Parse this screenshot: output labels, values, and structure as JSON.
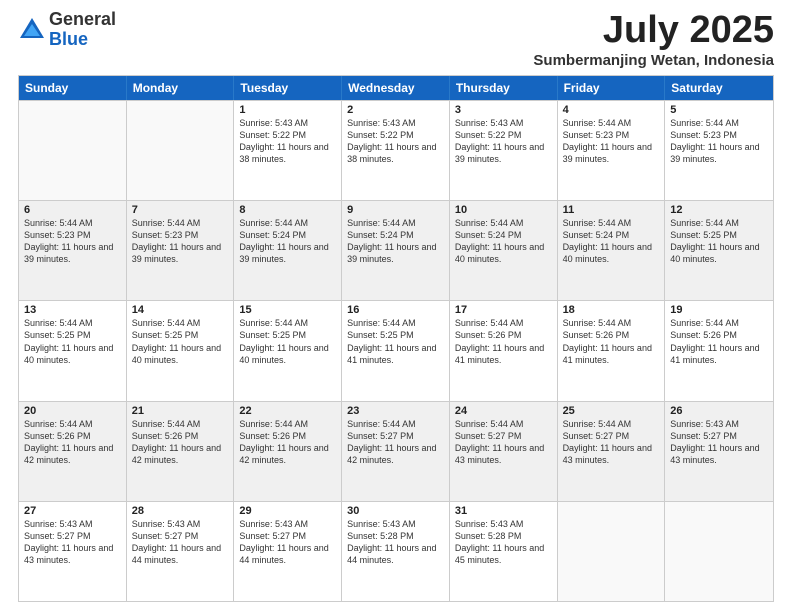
{
  "logo": {
    "general": "General",
    "blue": "Blue"
  },
  "title": "July 2025",
  "location": "Sumbermanjing Wetan, Indonesia",
  "header_days": [
    "Sunday",
    "Monday",
    "Tuesday",
    "Wednesday",
    "Thursday",
    "Friday",
    "Saturday"
  ],
  "weeks": [
    [
      {
        "day": "",
        "info": ""
      },
      {
        "day": "",
        "info": ""
      },
      {
        "day": "1",
        "info": "Sunrise: 5:43 AM\nSunset: 5:22 PM\nDaylight: 11 hours and 38 minutes."
      },
      {
        "day": "2",
        "info": "Sunrise: 5:43 AM\nSunset: 5:22 PM\nDaylight: 11 hours and 38 minutes."
      },
      {
        "day": "3",
        "info": "Sunrise: 5:43 AM\nSunset: 5:22 PM\nDaylight: 11 hours and 39 minutes."
      },
      {
        "day": "4",
        "info": "Sunrise: 5:44 AM\nSunset: 5:23 PM\nDaylight: 11 hours and 39 minutes."
      },
      {
        "day": "5",
        "info": "Sunrise: 5:44 AM\nSunset: 5:23 PM\nDaylight: 11 hours and 39 minutes."
      }
    ],
    [
      {
        "day": "6",
        "info": "Sunrise: 5:44 AM\nSunset: 5:23 PM\nDaylight: 11 hours and 39 minutes."
      },
      {
        "day": "7",
        "info": "Sunrise: 5:44 AM\nSunset: 5:23 PM\nDaylight: 11 hours and 39 minutes."
      },
      {
        "day": "8",
        "info": "Sunrise: 5:44 AM\nSunset: 5:24 PM\nDaylight: 11 hours and 39 minutes."
      },
      {
        "day": "9",
        "info": "Sunrise: 5:44 AM\nSunset: 5:24 PM\nDaylight: 11 hours and 39 minutes."
      },
      {
        "day": "10",
        "info": "Sunrise: 5:44 AM\nSunset: 5:24 PM\nDaylight: 11 hours and 40 minutes."
      },
      {
        "day": "11",
        "info": "Sunrise: 5:44 AM\nSunset: 5:24 PM\nDaylight: 11 hours and 40 minutes."
      },
      {
        "day": "12",
        "info": "Sunrise: 5:44 AM\nSunset: 5:25 PM\nDaylight: 11 hours and 40 minutes."
      }
    ],
    [
      {
        "day": "13",
        "info": "Sunrise: 5:44 AM\nSunset: 5:25 PM\nDaylight: 11 hours and 40 minutes."
      },
      {
        "day": "14",
        "info": "Sunrise: 5:44 AM\nSunset: 5:25 PM\nDaylight: 11 hours and 40 minutes."
      },
      {
        "day": "15",
        "info": "Sunrise: 5:44 AM\nSunset: 5:25 PM\nDaylight: 11 hours and 40 minutes."
      },
      {
        "day": "16",
        "info": "Sunrise: 5:44 AM\nSunset: 5:25 PM\nDaylight: 11 hours and 41 minutes."
      },
      {
        "day": "17",
        "info": "Sunrise: 5:44 AM\nSunset: 5:26 PM\nDaylight: 11 hours and 41 minutes."
      },
      {
        "day": "18",
        "info": "Sunrise: 5:44 AM\nSunset: 5:26 PM\nDaylight: 11 hours and 41 minutes."
      },
      {
        "day": "19",
        "info": "Sunrise: 5:44 AM\nSunset: 5:26 PM\nDaylight: 11 hours and 41 minutes."
      }
    ],
    [
      {
        "day": "20",
        "info": "Sunrise: 5:44 AM\nSunset: 5:26 PM\nDaylight: 11 hours and 42 minutes."
      },
      {
        "day": "21",
        "info": "Sunrise: 5:44 AM\nSunset: 5:26 PM\nDaylight: 11 hours and 42 minutes."
      },
      {
        "day": "22",
        "info": "Sunrise: 5:44 AM\nSunset: 5:26 PM\nDaylight: 11 hours and 42 minutes."
      },
      {
        "day": "23",
        "info": "Sunrise: 5:44 AM\nSunset: 5:27 PM\nDaylight: 11 hours and 42 minutes."
      },
      {
        "day": "24",
        "info": "Sunrise: 5:44 AM\nSunset: 5:27 PM\nDaylight: 11 hours and 43 minutes."
      },
      {
        "day": "25",
        "info": "Sunrise: 5:44 AM\nSunset: 5:27 PM\nDaylight: 11 hours and 43 minutes."
      },
      {
        "day": "26",
        "info": "Sunrise: 5:43 AM\nSunset: 5:27 PM\nDaylight: 11 hours and 43 minutes."
      }
    ],
    [
      {
        "day": "27",
        "info": "Sunrise: 5:43 AM\nSunset: 5:27 PM\nDaylight: 11 hours and 43 minutes."
      },
      {
        "day": "28",
        "info": "Sunrise: 5:43 AM\nSunset: 5:27 PM\nDaylight: 11 hours and 44 minutes."
      },
      {
        "day": "29",
        "info": "Sunrise: 5:43 AM\nSunset: 5:27 PM\nDaylight: 11 hours and 44 minutes."
      },
      {
        "day": "30",
        "info": "Sunrise: 5:43 AM\nSunset: 5:28 PM\nDaylight: 11 hours and 44 minutes."
      },
      {
        "day": "31",
        "info": "Sunrise: 5:43 AM\nSunset: 5:28 PM\nDaylight: 11 hours and 45 minutes."
      },
      {
        "day": "",
        "info": ""
      },
      {
        "day": "",
        "info": ""
      }
    ]
  ]
}
